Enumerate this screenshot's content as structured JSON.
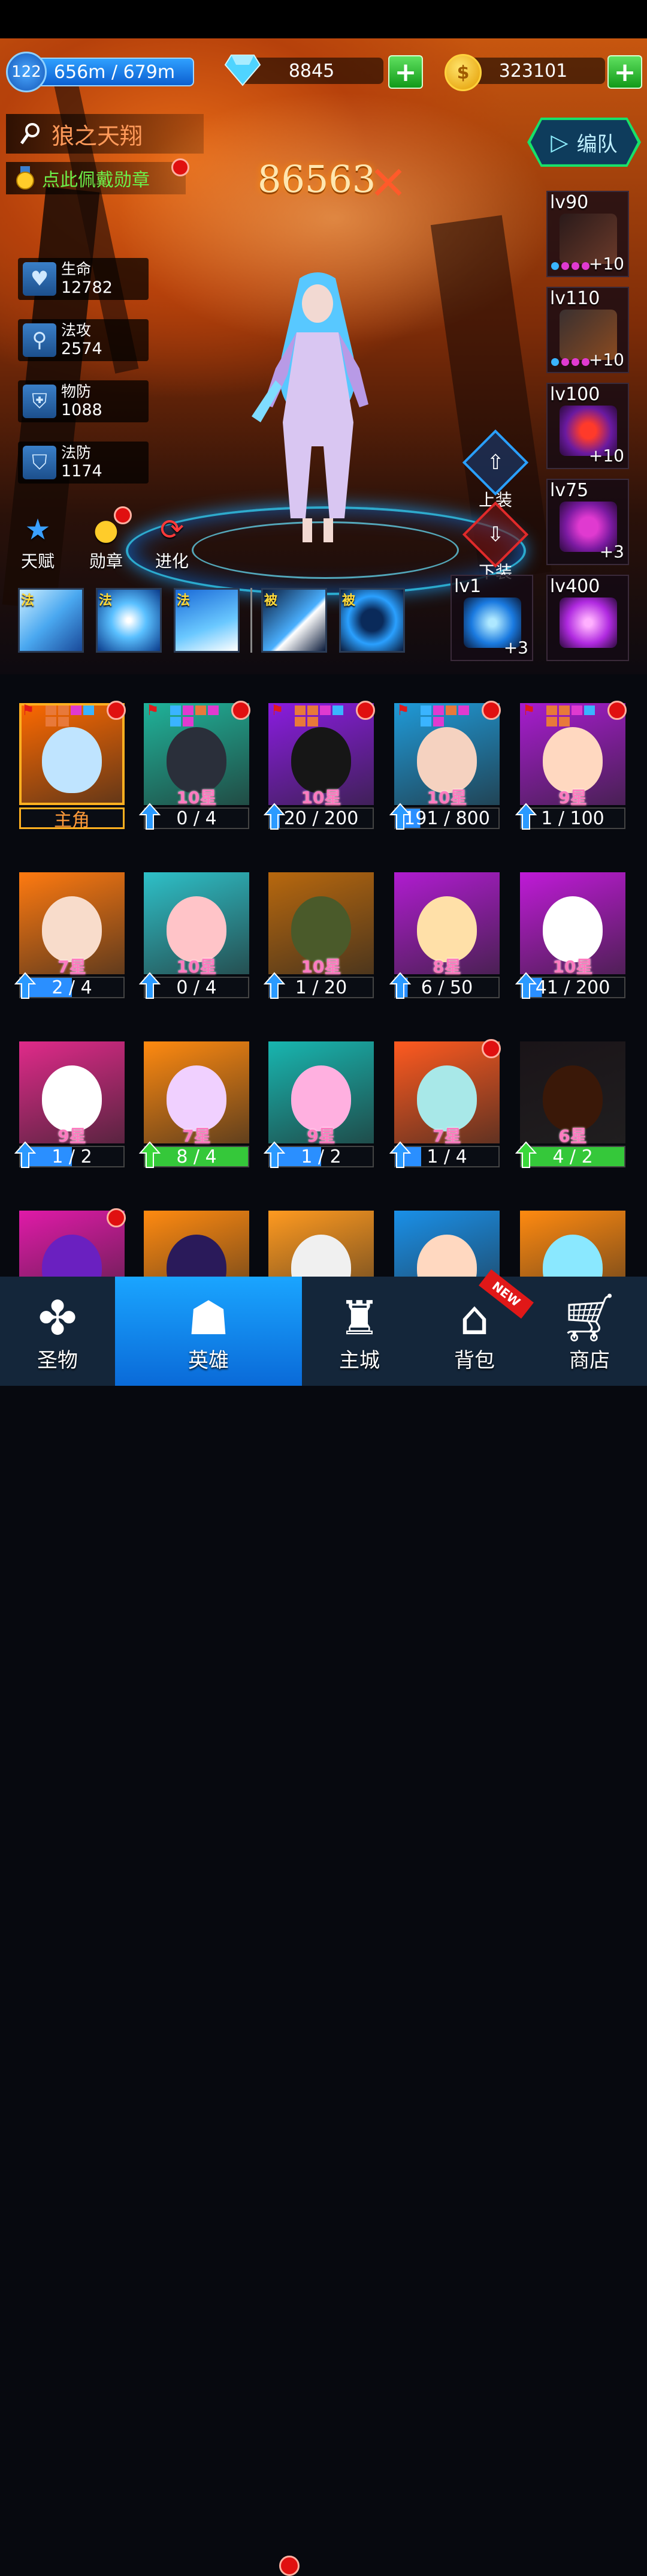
{
  "resources": {
    "level": "122",
    "energy": "656m / 679m",
    "gems": "8845",
    "gold": "323101"
  },
  "hero": {
    "name": "狼之天翔",
    "medal_hint": "点此佩戴勋章",
    "power": "86563",
    "team_button": "编队"
  },
  "stats": [
    {
      "label": "生命",
      "value": "12782",
      "icon": "heart-icon"
    },
    {
      "label": "法攻",
      "value": "2574",
      "icon": "staff-icon"
    },
    {
      "label": "物防",
      "value": "1088",
      "icon": "shield-icon"
    },
    {
      "label": "法防",
      "value": "1174",
      "icon": "magic-shield-icon"
    }
  ],
  "actions": {
    "talent": "天赋",
    "medal": "勋章",
    "evolve": "进化",
    "equip": "上装",
    "unequip": "下装"
  },
  "equipment": [
    {
      "level": "lv90",
      "plus": "+10",
      "kind": "weapon"
    },
    {
      "level": "lv110",
      "plus": "+10",
      "kind": "armor"
    },
    {
      "level": "lv100",
      "plus": "+10",
      "kind": "ring"
    },
    {
      "level": "lv75",
      "plus": "+3",
      "kind": "ring"
    },
    {
      "level": "lv1",
      "plus": "+3",
      "kind": "orb"
    },
    {
      "level": "lv400",
      "plus": "",
      "kind": "wings"
    }
  ],
  "skills": [
    {
      "tag": "法"
    },
    {
      "tag": "法"
    },
    {
      "tag": "法"
    },
    {
      "tag": "被"
    },
    {
      "tag": "被"
    }
  ],
  "heroes": [
    {
      "star": "",
      "progress": "主角",
      "pct": 0,
      "bar": "main",
      "bg": "#ff6a00",
      "face": "#bfe4ff"
    },
    {
      "star": "10星",
      "progress": "0 / 4",
      "pct": 0,
      "bar": "blue",
      "bg": "#1fb39a",
      "face": "#2a2f3a"
    },
    {
      "star": "10星",
      "progress": "20 / 200",
      "pct": 10,
      "bar": "blue",
      "bg": "#8a1ce0",
      "face": "#161616"
    },
    {
      "star": "10星",
      "progress": "191 / 800",
      "pct": 24,
      "bar": "blue",
      "bg": "#1f9ad8",
      "face": "#f5d2c0"
    },
    {
      "star": "9星",
      "progress": "1 / 100",
      "pct": 1,
      "bar": "blue",
      "bg": "#a81cd0",
      "face": "#ffd8c0"
    },
    {
      "star": "7星",
      "progress": "2 / 4",
      "pct": 50,
      "bar": "blue",
      "bg": "#ff7a10",
      "face": "#f8dccb"
    },
    {
      "star": "10星",
      "progress": "0 / 4",
      "pct": 0,
      "bar": "blue",
      "bg": "#2ec0c8",
      "face": "#ffc4c8"
    },
    {
      "star": "10星",
      "progress": "1 / 20",
      "pct": 5,
      "bar": "blue",
      "bg": "#b8680e",
      "face": "#4a5a2a"
    },
    {
      "star": "8星",
      "progress": "6 / 50",
      "pct": 12,
      "bar": "blue",
      "bg": "#b01cd0",
      "face": "#ffe0a8"
    },
    {
      "star": "10星",
      "progress": "41 / 200",
      "pct": 20,
      "bar": "blue",
      "bg": "#c01ad8",
      "face": "#ffffff"
    },
    {
      "star": "9星",
      "progress": "1 / 2",
      "pct": 50,
      "bar": "blue",
      "bg": "#e02a8a",
      "face": "#ffffff"
    },
    {
      "star": "7星",
      "progress": "8 / 4",
      "pct": 100,
      "bar": "green",
      "bg": "#ff8a10",
      "face": "#f0d0ff"
    },
    {
      "star": "9星",
      "progress": "1 / 2",
      "pct": 50,
      "bar": "blue",
      "bg": "#18b6b0",
      "face": "#ffb0e0"
    },
    {
      "star": "7星",
      "progress": "1 / 4",
      "pct": 25,
      "bar": "blue",
      "bg": "#ff5a20",
      "face": "#a8e8e8"
    },
    {
      "star": "6星",
      "progress": "4 / 2",
      "pct": 100,
      "bar": "green",
      "bg": "#1a1418",
      "face": "#3a1808"
    },
    {
      "star": "",
      "progress": "",
      "pct": 0,
      "bar": "none",
      "bg": "#e01aa8",
      "face": "#6a20c0"
    },
    {
      "star": "",
      "progress": "",
      "pct": 0,
      "bar": "none",
      "bg": "#ff8a10",
      "face": "#2a1a5a"
    },
    {
      "star": "",
      "progress": "",
      "pct": 0,
      "bar": "none",
      "bg": "#ff9a20",
      "face": "#f0f0f0"
    },
    {
      "star": "",
      "progress": "",
      "pct": 0,
      "bar": "none",
      "bg": "#1a90e8",
      "face": "#ffd8c0"
    },
    {
      "star": "",
      "progress": "",
      "pct": 0,
      "bar": "none",
      "bg": "#ff8a10",
      "face": "#8ae8ff"
    }
  ],
  "nav": [
    {
      "label": "圣物",
      "icon": "clover-icon",
      "active": false
    },
    {
      "label": "英雄",
      "icon": "hero-helmet-icon",
      "active": true
    },
    {
      "label": "主城",
      "icon": "castle-icon",
      "active": false
    },
    {
      "label": "背包",
      "icon": "backpack-icon",
      "active": false
    },
    {
      "label": "商店",
      "icon": "cart-icon",
      "active": false
    }
  ],
  "nav_new_badge": "NEW"
}
